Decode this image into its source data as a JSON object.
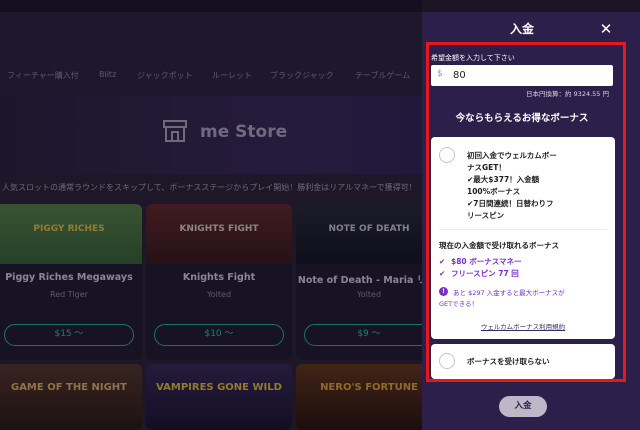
{
  "nav": {
    "items": [
      "フィーチャー購入付",
      "Blitz",
      "ジャックポット",
      "ルーレット",
      "ブラックジャック",
      "テーブルゲーム"
    ]
  },
  "banner": {
    "title": "me Store",
    "icon": "store-icon"
  },
  "promo_text": "人気スロットの通常ラウンドをスキップして、ボーナスステージからプレイ開始！勝利金はリアルマネーで獲得可！",
  "games": [
    {
      "title": "Piggy Riches Megaways",
      "provider": "Red Tiger",
      "price": "$15 〜",
      "logo": "PIGGY RICHES"
    },
    {
      "title": "Knights Fight",
      "provider": "Yolted",
      "price": "$10 〜",
      "logo": "KNIGHTS FIGHT"
    },
    {
      "title": "Note of Death - Maria リア)",
      "provider": "Yolted",
      "price": "$9 〜",
      "logo": "NOTE OF DEATH"
    }
  ],
  "games_row2": [
    {
      "logo": "GAME OF THE NIGHT"
    },
    {
      "logo": "VAMPIRES GONE WILD"
    },
    {
      "logo": "NERO'S FORTUNE"
    }
  ],
  "deposit": {
    "title": "入金",
    "close_icon": "close-icon",
    "amount_label": "希望金額を入力して下さい",
    "currency_symbol": "$",
    "amount_value": "80",
    "conversion": "日本円換算：約 9324.55 円",
    "bonus_heading": "今ならもらえるお得なボーナス",
    "welcome_bonus": {
      "lines": [
        "初回入金でウェルカムボー",
        "ナスGET！",
        "✔最大$377！入金額",
        "100%ボーナス",
        "✔7日間連続！日替わりフ",
        "リースピン"
      ],
      "current_title": "現在の入金額で受け取れるボーナス",
      "current_items": [
        "$80 ボーナスマネー",
        "フリースピン 77 回"
      ],
      "info_lines": [
        "あと $297 入金すると最大ボーナスが",
        "GETできる！"
      ],
      "terms_link": "ウェルカムボーナス利用規約"
    },
    "no_bonus_label": "ボーナスを受け取らない",
    "deposit_button": "入金"
  },
  "colors": {
    "panel": "#2c1f4a",
    "highlight": "#e8161d",
    "accent": "#7a2fc7",
    "price": "#2fd3af"
  }
}
